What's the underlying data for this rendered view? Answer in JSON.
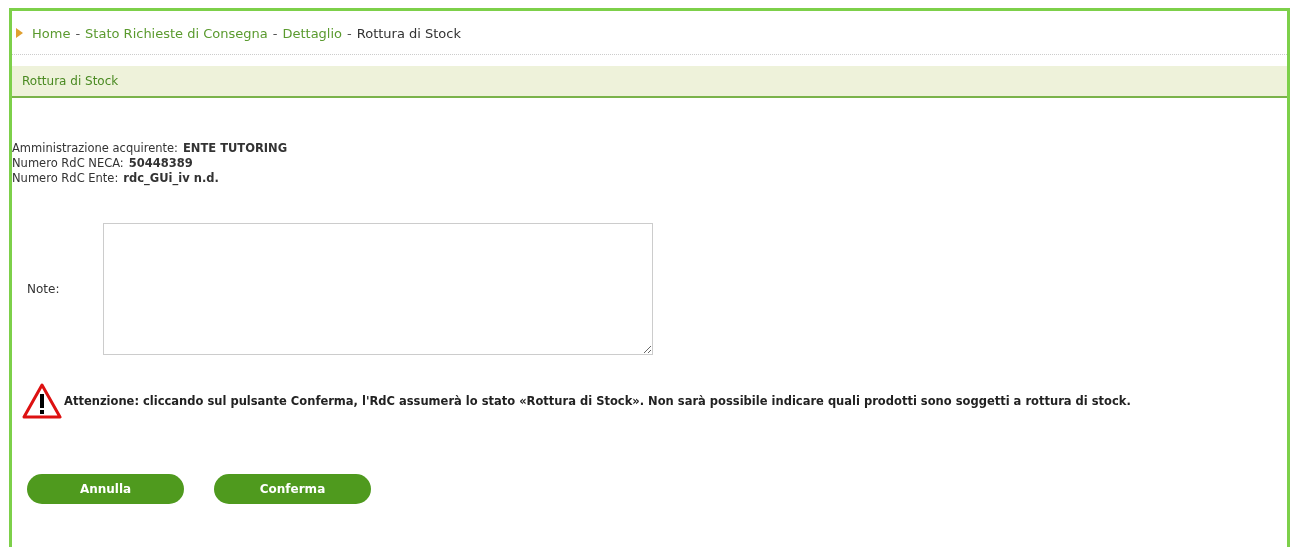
{
  "breadcrumb": [
    {
      "label": "Home",
      "kind": "link"
    },
    {
      "label": "Stato Richieste di Consegna",
      "kind": "link"
    },
    {
      "label": "Dettaglio",
      "kind": "link"
    },
    {
      "label": "Rottura di Stock",
      "kind": "current"
    }
  ],
  "breadcrumb_separator": "-",
  "section_title": "Rottura di Stock",
  "info": [
    {
      "label": "Amministrazione acquirente:",
      "value": "ENTE TUTORING"
    },
    {
      "label": "Numero RdC NECA:",
      "value": "50448389"
    },
    {
      "label": "Numero RdC Ente:",
      "value": "rdc_GUi_iv n.d."
    }
  ],
  "note": {
    "label": "Note:"
  },
  "warning": "Attenzione: cliccando sul pulsante Conferma, l'RdC assumerà lo stato «Rottura di Stock». Non sarà possibile indicare quali prodotti sono soggetti a rottura di stock.",
  "buttons": [
    "Annulla",
    "Conferma"
  ]
}
